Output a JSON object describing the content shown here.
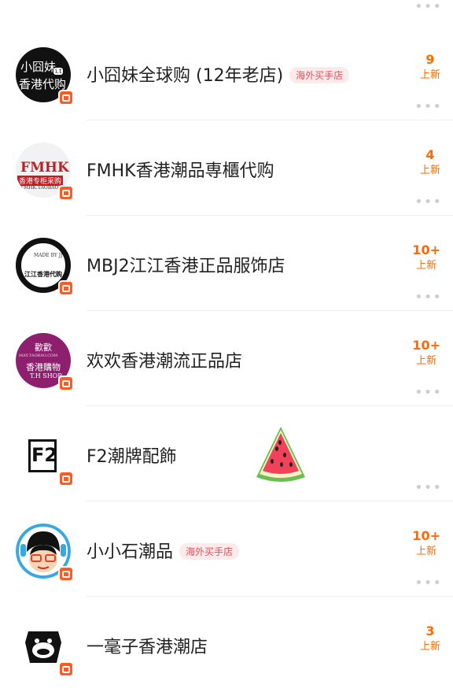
{
  "top": {
    "more": "•••"
  },
  "shops": [
    {
      "name": "小囧妹全球购 (12年老店)",
      "tag": "海外买手店",
      "count": "9",
      "new_label": "上新",
      "more": "•••"
    },
    {
      "name": "FMHK香港潮品専櫃代购",
      "tag": "",
      "count": "4",
      "new_label": "上新",
      "more": "•••"
    },
    {
      "name": "MBJ2江江香港正品服饰店",
      "tag": "",
      "count": "10+",
      "new_label": "上新",
      "more": "•••"
    },
    {
      "name": "欢欢香港潮流正品店",
      "tag": "",
      "count": "10+",
      "new_label": "上新",
      "more": "•••"
    },
    {
      "name": "F2潮牌配飾",
      "tag": "",
      "count": "",
      "new_label": "",
      "more": "•••"
    },
    {
      "name": "小小石潮品",
      "tag": "海外买手店",
      "count": "10+",
      "new_label": "上新",
      "more": "•••"
    },
    {
      "name": "一毫子香港潮店",
      "tag": "",
      "count": "3",
      "new_label": "上新",
      "more": "•••"
    }
  ],
  "avatars": {
    "a1": {
      "l1": "小囧妹",
      "l2": "香港代购",
      "badge": "i.t"
    },
    "a2": {
      "l1": "FMHK",
      "l2": "香港专柜采购",
      "l3": "FMHK.TAOBAO"
    },
    "a3": {
      "l1": "MADE BY JJ",
      "l2": "江江香港代购"
    },
    "a4": {
      "l1": "歡歡",
      "l2": "香港購物",
      "l3": "T.H SHOP",
      "l4": "MAY.TAOBAO.COM"
    },
    "a5": {
      "l1": "F2"
    }
  },
  "colors": {
    "accent": "#ff6a00",
    "tag_text": "#e24d5a",
    "tag_bg": "#fdebec",
    "tmall": "#ff5a1f"
  },
  "icons": {
    "row_more": "more-icon",
    "badge": "tmall-icon",
    "decoration": "watermelon-icon"
  }
}
